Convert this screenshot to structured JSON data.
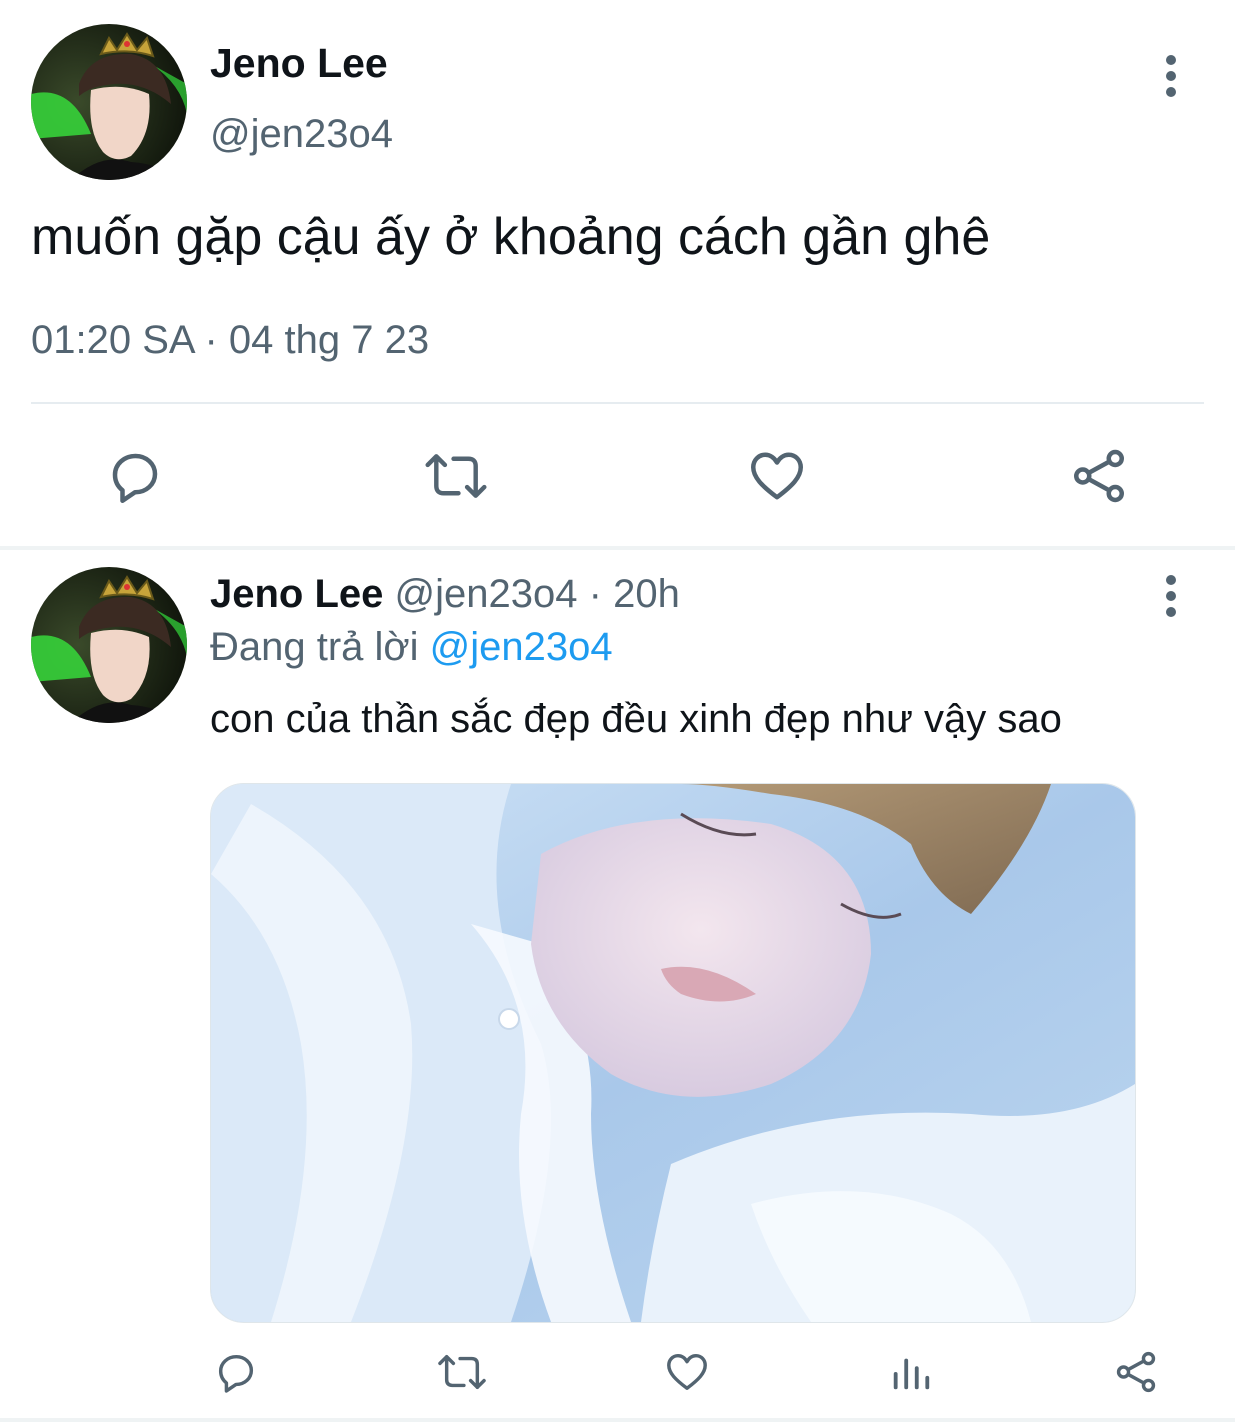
{
  "main_tweet": {
    "author_name": "Jeno Lee",
    "author_handle": "@jen23o4",
    "avatar_icon": "profile-photo-avatar",
    "text": "muốn gặp cậu ấy ở khoảng cách gần ghê",
    "timestamp": "01:20 SA · 04 thg 7 23",
    "more_icon": "vertical-dots-icon",
    "actions": [
      "reply-icon",
      "retweet-icon",
      "like-icon",
      "share-icon"
    ]
  },
  "reply_tweet": {
    "author_name": "Jeno Lee",
    "author_handle": "@jen23o4",
    "separator_dot": "·",
    "time_ago": "20h",
    "replying_prefix": "Đang trả lời",
    "replying_to": "@jen23o4",
    "text": "con của thần sắc đẹp đều xinh đẹp như vậy sao",
    "media": "attached-photo",
    "more_icon": "vertical-dots-icon",
    "actions": [
      "reply-icon",
      "retweet-icon",
      "like-icon",
      "views-icon",
      "share-icon"
    ]
  },
  "colors": {
    "primary_text": "#0f1419",
    "secondary_text": "#536471",
    "link": "#1d9bf0",
    "divider": "#e6ecf0"
  }
}
